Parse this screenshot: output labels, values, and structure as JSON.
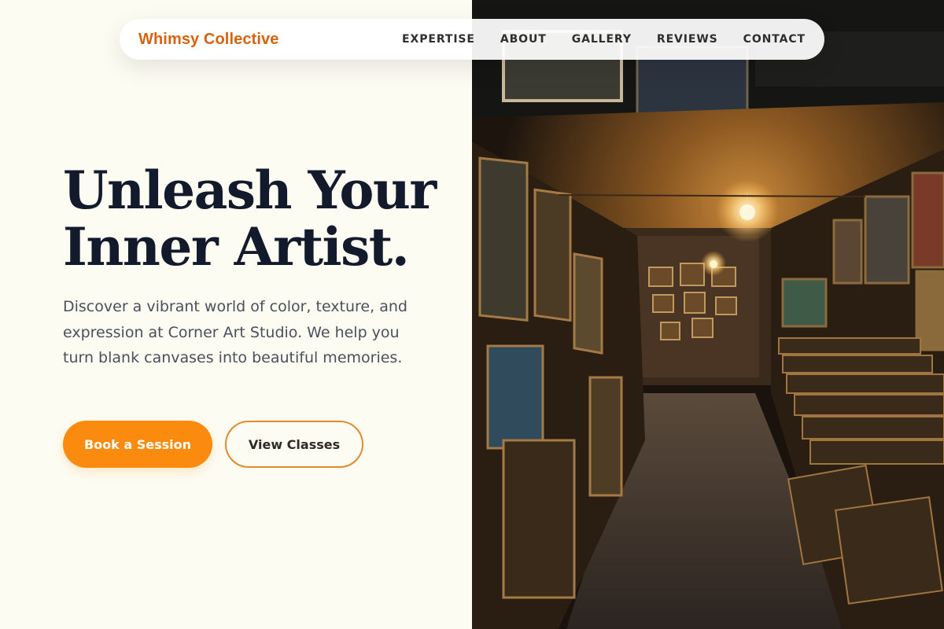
{
  "brand": {
    "name": "Whimsy Collective"
  },
  "nav": {
    "items": [
      {
        "label": "EXPERTISE"
      },
      {
        "label": "ABOUT"
      },
      {
        "label": "GALLERY"
      },
      {
        "label": "REVIEWS"
      },
      {
        "label": "CONTACT"
      }
    ]
  },
  "hero": {
    "title_line1": "Unleash Your",
    "title_line2": "Inner Artist.",
    "description": "Discover a vibrant world of color, texture, and expression at Corner Art Studio. We help you turn blank canvases into beautiful memories.",
    "primary_cta": "Book a Session",
    "secondary_cta": "View Classes"
  },
  "colors": {
    "accent": "#fb8b0f",
    "brand": "#d9620d",
    "heading": "#131a2c",
    "background": "#fdfcf3"
  }
}
